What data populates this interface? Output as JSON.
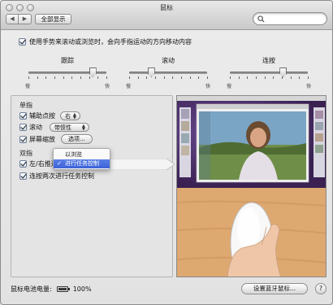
{
  "window": {
    "title": "鼠标"
  },
  "toolbar": {
    "back_icon": "◀",
    "forward_icon": "▶",
    "show_all_label": "全部显示",
    "search_placeholder": ""
  },
  "options": {
    "scroll_direction_label": "使用手势来滚动或浏览时，会向手指运动的方向移动内容",
    "scroll_direction_checked": true
  },
  "sliders": [
    {
      "label": "跟踪",
      "min_label": "慢",
      "max_label": "快",
      "value": 0.82
    },
    {
      "label": "滚动",
      "min_label": "慢",
      "max_label": "快",
      "value": 0.28
    },
    {
      "label": "连按",
      "min_label": "慢",
      "max_label": "快",
      "value": 0.68
    }
  ],
  "single_finger": {
    "heading": "单指",
    "secondary_click": {
      "label": "辅助点按",
      "value": "右",
      "checked": true
    },
    "scrolling": {
      "label": "滚动",
      "value": "带惯性",
      "checked": true
    },
    "screen_zoom": {
      "label": "屏幕缩放",
      "button": "选项...",
      "checked": true
    }
  },
  "two_finger": {
    "heading": "双指",
    "swipe": {
      "label": "左/右推送",
      "checked": true
    },
    "mission_control": {
      "label": "连按两次进行任务控制",
      "checked": true
    }
  },
  "dropdown_menu": {
    "items": [
      "以浏览",
      "进行任务控制"
    ],
    "selected_index": 1
  },
  "footer": {
    "battery_label": "鼠标电池电量:",
    "battery_value": "100%",
    "battery_fraction": 1.0,
    "bluetooth_button": "设置蓝牙鼠标...",
    "help_label": "?"
  },
  "colors": {
    "selection": "#3c62d8",
    "desktop_purple": "#5a3b86",
    "wood": "#d9a470"
  }
}
